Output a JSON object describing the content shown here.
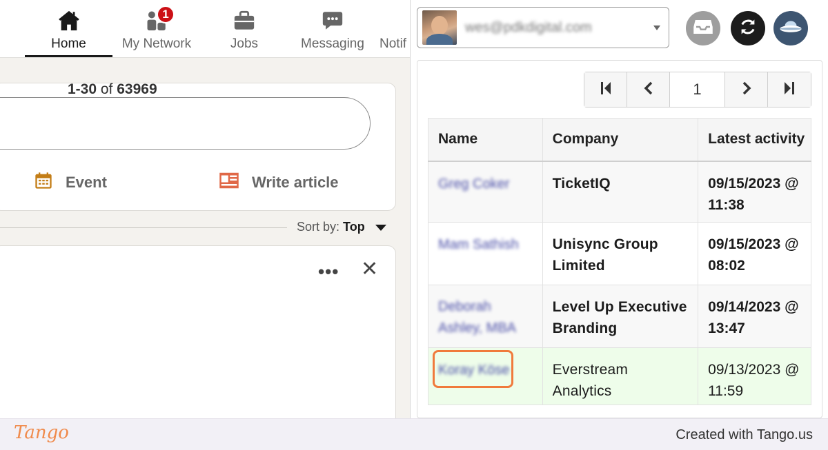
{
  "nav": {
    "items": [
      {
        "label": "Home",
        "icon": "home-icon",
        "active": true
      },
      {
        "label": "My Network",
        "icon": "network-icon",
        "badge": "1"
      },
      {
        "label": "Jobs",
        "icon": "briefcase-icon"
      },
      {
        "label": "Messaging",
        "icon": "message-icon"
      },
      {
        "label": "Notif",
        "icon": "bell-icon"
      }
    ]
  },
  "feed": {
    "actions": [
      {
        "label": "Event",
        "icon": "calendar-icon",
        "color": "#c37d16"
      },
      {
        "label": "Write article",
        "icon": "article-icon",
        "color": "#e06847"
      }
    ],
    "sort_label": "Sort by:",
    "sort_value": "Top",
    "post_more": "•••",
    "post_close": "✕"
  },
  "extension": {
    "account_email": "wes@pdkdigital.com",
    "pager": {
      "range": "1-30",
      "of": "of",
      "total": "63969",
      "page": "1"
    },
    "table": {
      "headers": [
        "Name",
        "Company",
        "Latest activity"
      ],
      "rows": [
        {
          "name": "Greg Coker",
          "company": "TicketIQ",
          "activity": "09/15/2023 @ 11:38"
        },
        {
          "name": "Mam Sathish",
          "company": "Unisync Group Limited",
          "activity": "09/15/2023 @ 08:02"
        },
        {
          "name": "Deborah Ashley, MBA",
          "company": "Level Up Executive Branding",
          "activity": "09/14/2023 @ 13:47"
        },
        {
          "name": "Koray Köse",
          "company": "Everstream Analytics",
          "activity": "09/13/2023 @ 11:59"
        }
      ]
    }
  },
  "footer": {
    "logo": "Tango",
    "credit": "Created with Tango.us"
  }
}
